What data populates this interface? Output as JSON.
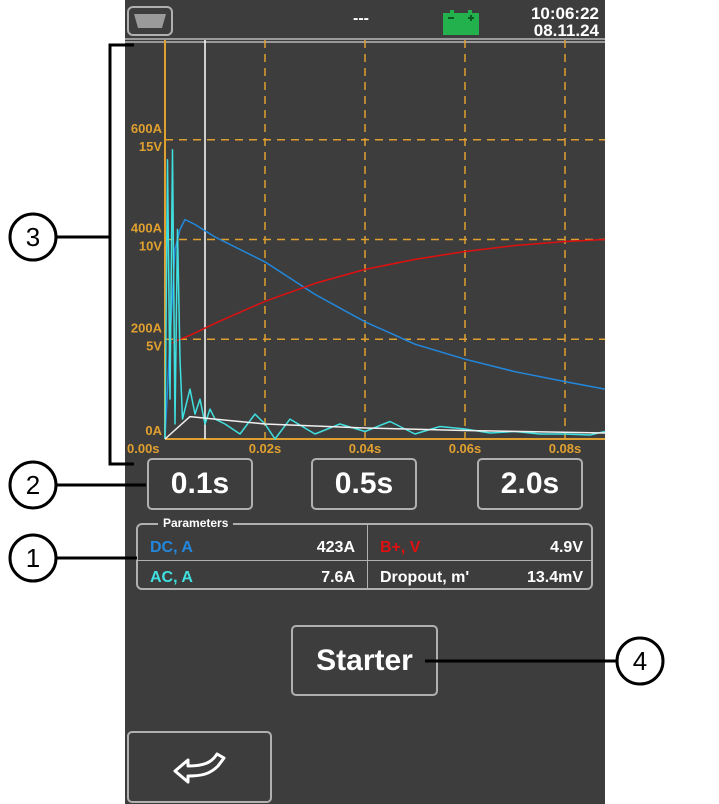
{
  "status_bar": {
    "left_icon": "card-slot-icon",
    "center_text": "---",
    "battery_icon": "battery-icon",
    "battery_color": "#22b14c",
    "time": "10:06:22",
    "date": "08.11.24"
  },
  "chart_data": {
    "type": "line",
    "x_ticks": [
      "0.00s",
      "0.02s",
      "0.04s",
      "0.06s",
      "0.08s"
    ],
    "y_ticks_current": [
      "0A",
      "200A",
      "400A",
      "600A"
    ],
    "y_ticks_voltage": [
      "5V",
      "10V",
      "15V"
    ],
    "xlim": [
      0,
      0.088
    ],
    "ylim_current": [
      0,
      600
    ],
    "ylim_voltage": [
      0,
      15
    ],
    "cursor_x": 0.008,
    "grid": true,
    "grid_color": "#e0a030",
    "series": [
      {
        "color": "#2288dd",
        "unit": "A",
        "x": [
          0,
          0.001,
          0.002,
          0.003,
          0.004,
          0.006,
          0.01,
          0.02,
          0.03,
          0.04,
          0.05,
          0.06,
          0.07,
          0.08,
          0.088
        ],
        "y": [
          0,
          200,
          380,
          420,
          440,
          430,
          405,
          355,
          290,
          235,
          190,
          160,
          135,
          115,
          100
        ]
      },
      {
        "color": "#e01010",
        "unit": "V",
        "x": [
          0.0015,
          0.002,
          0.005,
          0.01,
          0.02,
          0.03,
          0.04,
          0.05,
          0.06,
          0.07,
          0.08,
          0.088
        ],
        "y": [
          4.8,
          4.9,
          5.2,
          5.8,
          6.9,
          7.8,
          8.5,
          9.0,
          9.4,
          9.7,
          9.9,
          10.0
        ]
      },
      {
        "color": "#40e0e0",
        "unit": "A",
        "x": [
          0,
          0.0005,
          0.001,
          0.0015,
          0.002,
          0.0025,
          0.003,
          0.0035,
          0.004,
          0.005,
          0.006,
          0.007,
          0.008,
          0.009,
          0.01,
          0.012,
          0.015,
          0.018,
          0.02,
          0.022,
          0.025,
          0.03,
          0.035,
          0.04,
          0.045,
          0.05,
          0.055,
          0.06,
          0.065,
          0.07,
          0.075,
          0.08,
          0.085,
          0.088
        ],
        "y": [
          0,
          560,
          80,
          580,
          30,
          420,
          160,
          40,
          60,
          100,
          50,
          80,
          30,
          60,
          40,
          30,
          10,
          50,
          30,
          0,
          40,
          10,
          30,
          15,
          35,
          10,
          25,
          20,
          12,
          15,
          10,
          10,
          8,
          15
        ]
      },
      {
        "color": "#f0f0f0",
        "unit": "A",
        "x": [
          0,
          0.005,
          0.01,
          0.02,
          0.04,
          0.06,
          0.088
        ],
        "y": [
          0,
          45,
          40,
          30,
          22,
          17,
          12
        ]
      }
    ]
  },
  "timebase_buttons": [
    "0.1s",
    "0.5s",
    "2.0s"
  ],
  "parameters": {
    "title": "Parameters",
    "rows": [
      {
        "label": "DC, A",
        "value": "423A",
        "color": "#2288dd"
      },
      {
        "label": "B+, V",
        "value": "4.9V",
        "color": "#e01010"
      },
      {
        "label": "AC, A",
        "value": "7.6A",
        "color": "#40e0e0"
      },
      {
        "label": "Dropout, m'",
        "value": "13.4mV",
        "color": "#ffffff"
      }
    ]
  },
  "starter_button": "Starter",
  "back_icon": "back-arrow-icon",
  "callouts": [
    "1",
    "2",
    "3",
    "4"
  ]
}
